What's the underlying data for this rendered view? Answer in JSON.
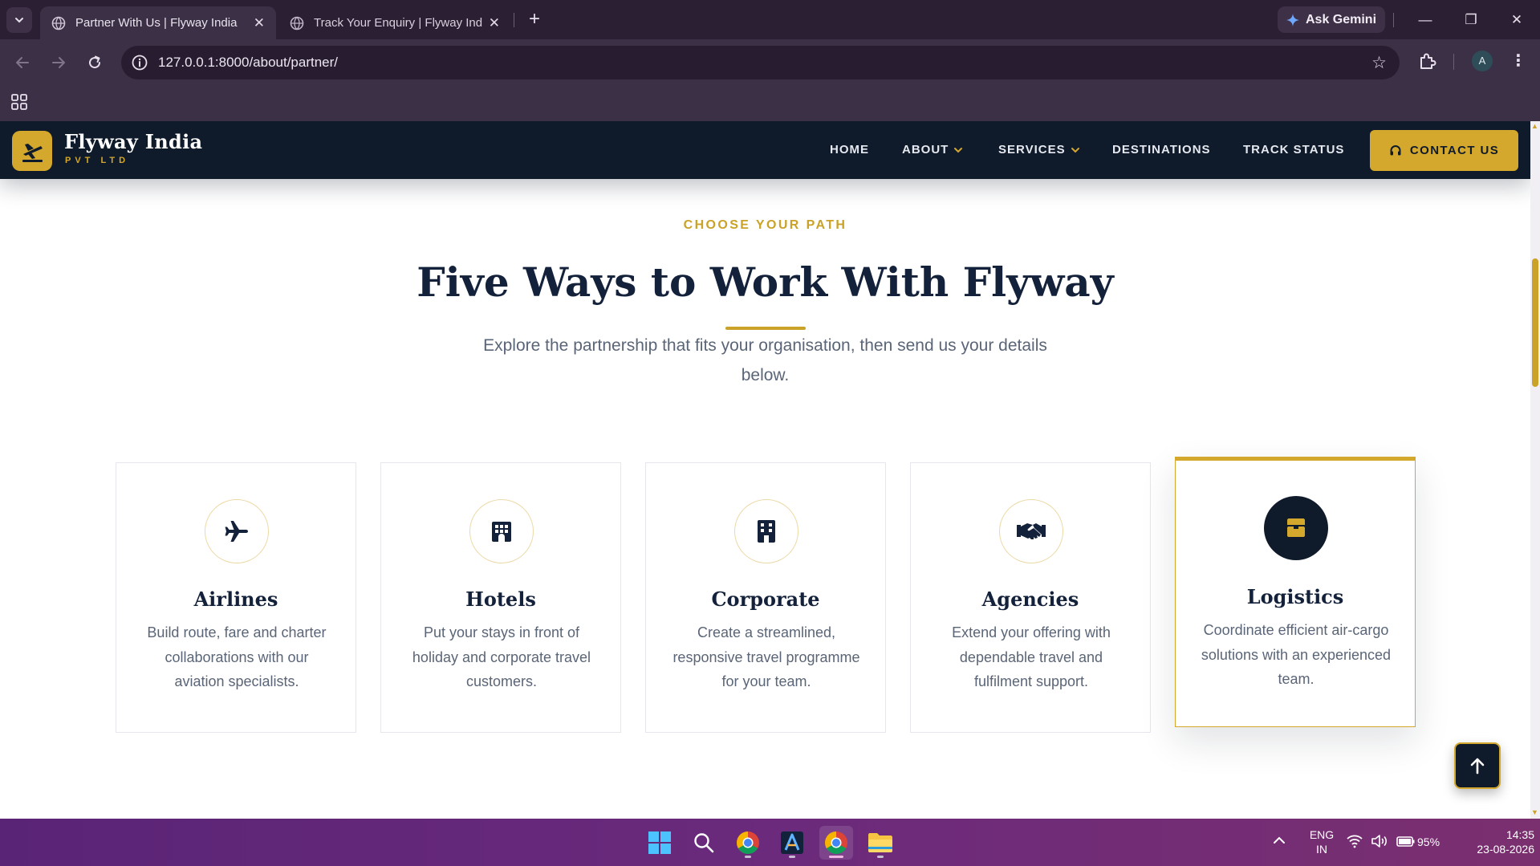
{
  "browser": {
    "tabs": [
      {
        "title": "Partner With Us | Flyway India",
        "active": true
      },
      {
        "title": "Track Your Enquiry | Flyway India",
        "active": false
      }
    ],
    "new_tab": "+",
    "gemini_label": "Ask Gemini",
    "url": "127.0.0.1:8000/about/partner/",
    "profile_initial": "A"
  },
  "site": {
    "brand": {
      "name": "Flyway India",
      "tagline": "PVT LTD"
    },
    "nav": {
      "home": "HOME",
      "about": "ABOUT",
      "services": "SERVICES",
      "destinations": "DESTINATIONS",
      "track": "TRACK STATUS",
      "contact": "CONTACT US"
    },
    "section": {
      "eyebrow": "CHOOSE YOUR PATH",
      "title": "Five Ways to Work With Flyway",
      "subtitle": "Explore the partnership that fits your organisation, then send us your details below."
    },
    "cards": [
      {
        "title": "Airlines",
        "text": "Build route, fare and charter collaborations with our aviation specialists.",
        "icon": "plane-icon"
      },
      {
        "title": "Hotels",
        "text": "Put your stays in front of holiday and corporate travel customers.",
        "icon": "hotel-icon"
      },
      {
        "title": "Corporate",
        "text": "Create a streamlined, responsive travel programme for your team.",
        "icon": "building-icon"
      },
      {
        "title": "Agencies",
        "text": "Extend your offering with dependable travel and fulfilment support.",
        "icon": "handshake-icon"
      },
      {
        "title": "Logistics",
        "text": "Coordinate efficient air-cargo solutions with an experienced team.",
        "icon": "box-icon",
        "featured": true
      }
    ],
    "colors": {
      "navy": "#0f1a2b",
      "gold": "#d4a82c",
      "muted": "#5a6577"
    }
  },
  "taskbar": {
    "lang_top": "ENG",
    "lang_bottom": "IN",
    "battery": "95%",
    "time": "14:35",
    "date": "23-08-2026"
  }
}
